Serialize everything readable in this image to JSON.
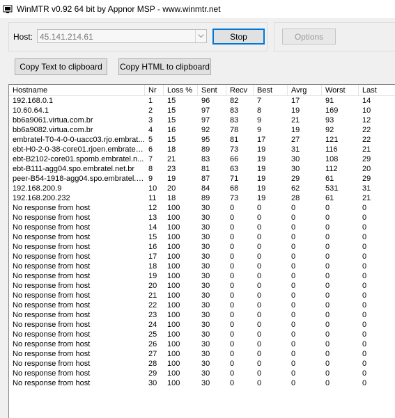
{
  "window": {
    "title": "WinMTR v0.92 64 bit by Appnor MSP - www.winmtr.net",
    "icon": "winmtr-app-icon"
  },
  "host": {
    "label": "Host:",
    "value": "45.141.214.61"
  },
  "buttons": {
    "stop": "Stop",
    "options": "Options",
    "copy_text": "Copy Text to clipboard",
    "copy_html": "Copy HTML to clipboard"
  },
  "table": {
    "columns": [
      "Hostname",
      "Nr",
      "Loss %",
      "Sent",
      "Recv",
      "Best",
      "Avrg",
      "Worst",
      "Last"
    ],
    "rows": [
      [
        "192.168.0.1",
        "1",
        "15",
        "96",
        "82",
        "7",
        "17",
        "91",
        "14"
      ],
      [
        "10.60.64.1",
        "2",
        "15",
        "97",
        "83",
        "8",
        "19",
        "169",
        "10"
      ],
      [
        "bb6a9061.virtua.com.br",
        "3",
        "15",
        "97",
        "83",
        "9",
        "21",
        "93",
        "12"
      ],
      [
        "bb6a9082.virtua.com.br",
        "4",
        "16",
        "92",
        "78",
        "9",
        "19",
        "92",
        "22"
      ],
      [
        "embratel-T0-4-0-0-uacc03.rjo.embrat...",
        "5",
        "15",
        "95",
        "81",
        "17",
        "27",
        "121",
        "22"
      ],
      [
        "ebt-H0-2-0-38-core01.rjoen.embratel....",
        "6",
        "18",
        "89",
        "73",
        "19",
        "31",
        "116",
        "21"
      ],
      [
        "ebt-B2102-core01.spomb.embratel.n...",
        "7",
        "21",
        "83",
        "66",
        "19",
        "30",
        "108",
        "29"
      ],
      [
        "ebt-B111-agg04.spo.embratel.net.br",
        "8",
        "23",
        "81",
        "63",
        "19",
        "30",
        "112",
        "20"
      ],
      [
        "peer-B54-1918-agg04.spo.embratel.n...",
        "9",
        "19",
        "87",
        "71",
        "19",
        "29",
        "61",
        "29"
      ],
      [
        "192.168.200.9",
        "10",
        "20",
        "84",
        "68",
        "19",
        "62",
        "531",
        "31"
      ],
      [
        "192.168.200.232",
        "11",
        "18",
        "89",
        "73",
        "19",
        "28",
        "61",
        "21"
      ],
      [
        "No response from host",
        "12",
        "100",
        "30",
        "0",
        "0",
        "0",
        "0",
        "0"
      ],
      [
        "No response from host",
        "13",
        "100",
        "30",
        "0",
        "0",
        "0",
        "0",
        "0"
      ],
      [
        "No response from host",
        "14",
        "100",
        "30",
        "0",
        "0",
        "0",
        "0",
        "0"
      ],
      [
        "No response from host",
        "15",
        "100",
        "30",
        "0",
        "0",
        "0",
        "0",
        "0"
      ],
      [
        "No response from host",
        "16",
        "100",
        "30",
        "0",
        "0",
        "0",
        "0",
        "0"
      ],
      [
        "No response from host",
        "17",
        "100",
        "30",
        "0",
        "0",
        "0",
        "0",
        "0"
      ],
      [
        "No response from host",
        "18",
        "100",
        "30",
        "0",
        "0",
        "0",
        "0",
        "0"
      ],
      [
        "No response from host",
        "19",
        "100",
        "30",
        "0",
        "0",
        "0",
        "0",
        "0"
      ],
      [
        "No response from host",
        "20",
        "100",
        "30",
        "0",
        "0",
        "0",
        "0",
        "0"
      ],
      [
        "No response from host",
        "21",
        "100",
        "30",
        "0",
        "0",
        "0",
        "0",
        "0"
      ],
      [
        "No response from host",
        "22",
        "100",
        "30",
        "0",
        "0",
        "0",
        "0",
        "0"
      ],
      [
        "No response from host",
        "23",
        "100",
        "30",
        "0",
        "0",
        "0",
        "0",
        "0"
      ],
      [
        "No response from host",
        "24",
        "100",
        "30",
        "0",
        "0",
        "0",
        "0",
        "0"
      ],
      [
        "No response from host",
        "25",
        "100",
        "30",
        "0",
        "0",
        "0",
        "0",
        "0"
      ],
      [
        "No response from host",
        "26",
        "100",
        "30",
        "0",
        "0",
        "0",
        "0",
        "0"
      ],
      [
        "No response from host",
        "27",
        "100",
        "30",
        "0",
        "0",
        "0",
        "0",
        "0"
      ],
      [
        "No response from host",
        "28",
        "100",
        "30",
        "0",
        "0",
        "0",
        "0",
        "0"
      ],
      [
        "No response from host",
        "29",
        "100",
        "30",
        "0",
        "0",
        "0",
        "0",
        "0"
      ],
      [
        "No response from host",
        "30",
        "100",
        "30",
        "0",
        "0",
        "0",
        "0",
        "0"
      ]
    ]
  },
  "colors": {
    "focus_border": "#0078d7",
    "disabled_text": "#9a9a9a"
  }
}
